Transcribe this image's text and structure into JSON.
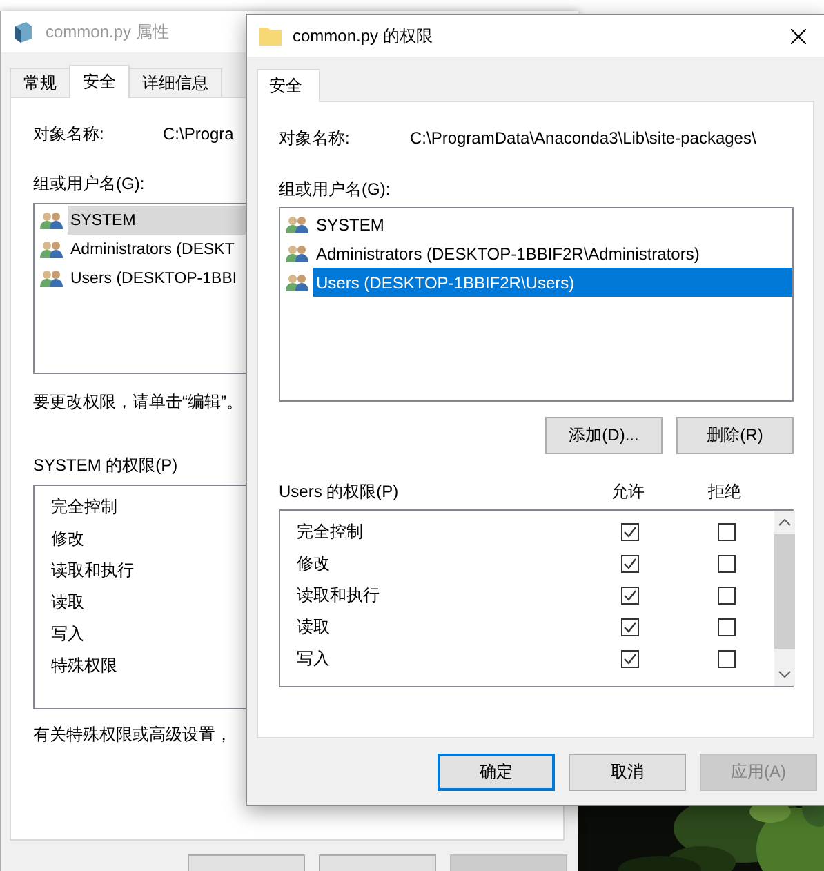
{
  "back_window": {
    "title": "common.py 属性",
    "tabs": [
      {
        "label": "常规",
        "selected": false
      },
      {
        "label": "安全",
        "selected": true
      },
      {
        "label": "详细信息",
        "selected": false
      }
    ],
    "object_name_label": "对象名称:",
    "object_name": "C:\\Progra",
    "groups_label": "组或用户名(G):",
    "groups": [
      {
        "name": "SYSTEM",
        "selected": true
      },
      {
        "name": "Administrators (DESKT",
        "selected": false
      },
      {
        "name": "Users (DESKTOP-1BBI",
        "selected": false
      }
    ],
    "edit_hint": "要更改权限，请单击“编辑”。",
    "permissions_label": "SYSTEM 的权限(P)",
    "permissions": [
      "完全控制",
      "修改",
      "读取和执行",
      "读取",
      "写入",
      "特殊权限"
    ],
    "advanced_hint": "有关特殊权限或高级设置，"
  },
  "dialog": {
    "title": "common.py 的权限",
    "tabs": [
      {
        "label": "安全",
        "selected": true
      }
    ],
    "object_name_label": "对象名称:",
    "object_name": "C:\\ProgramData\\Anaconda3\\Lib\\site-packages\\",
    "groups_label": "组或用户名(G):",
    "groups": [
      {
        "name": "SYSTEM",
        "selected": false
      },
      {
        "name": "Administrators (DESKTOP-1BBIF2R\\Administrators)",
        "selected": false
      },
      {
        "name": "Users (DESKTOP-1BBIF2R\\Users)",
        "selected": true
      }
    ],
    "group_buttons": [
      "添加(D)...",
      "删除(R)"
    ],
    "permissions_label": "Users 的权限(P)",
    "columns": [
      "允许",
      "拒绝"
    ],
    "permissions": [
      {
        "name": "完全控制",
        "allow": true,
        "deny": false
      },
      {
        "name": "修改",
        "allow": true,
        "deny": false
      },
      {
        "name": "读取和执行",
        "allow": true,
        "deny": false
      },
      {
        "name": "读取",
        "allow": true,
        "deny": false
      },
      {
        "name": "写入",
        "allow": true,
        "deny": false
      }
    ],
    "buttons": [
      {
        "label": "确定",
        "default": true,
        "disabled": false
      },
      {
        "label": "取消",
        "default": false,
        "disabled": false
      },
      {
        "label": "应用(A)",
        "default": false,
        "disabled": true
      }
    ]
  }
}
